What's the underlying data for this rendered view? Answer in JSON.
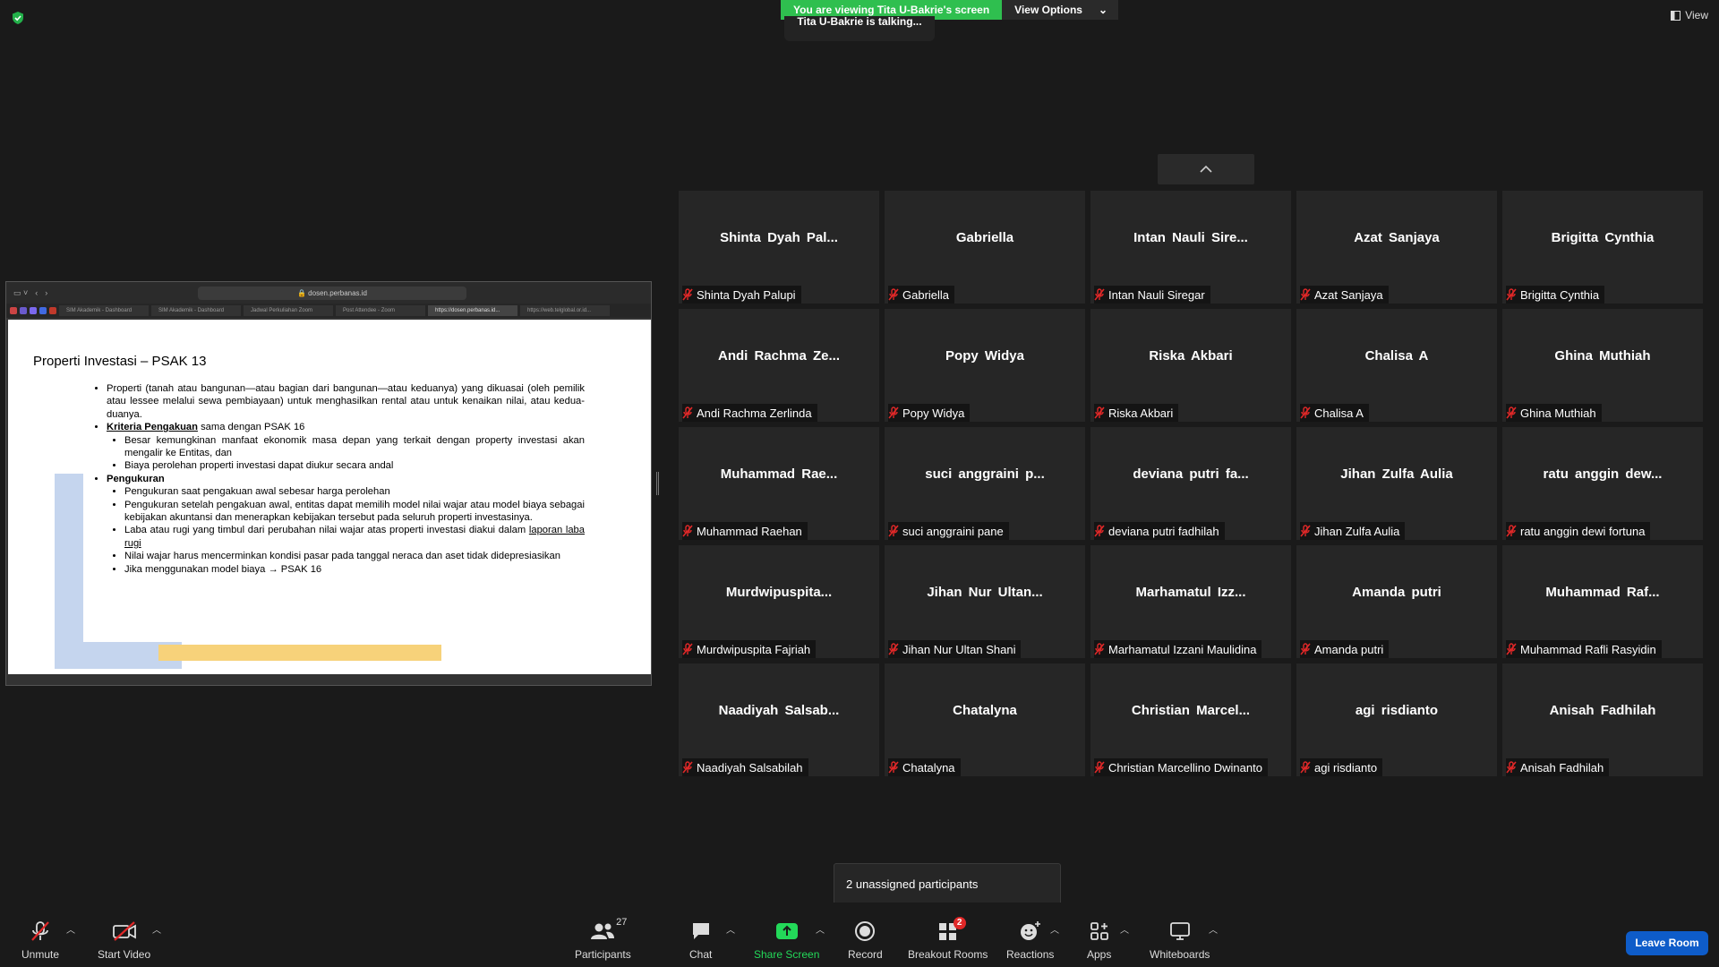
{
  "meeting": {
    "banner": "You are viewing Tita U-Bakrie's screen",
    "view_options": "View Options",
    "talking": "Tita U-Bakrie is talking...",
    "view": "View",
    "unassigned_popup": "2 unassigned participants"
  },
  "shared_screen": {
    "url": "dosen.perbanas.id",
    "tabs": [
      "SIM Akademik - Dashboard",
      "SIM Akademik - Dashboard",
      "Jadwal Perkuliahan Zoom",
      "Post Attendee - Zoom",
      "https://dosen.perbanas.id...",
      "https://web.telglobal.or.id..."
    ],
    "slide": {
      "title": "Properti  Investasi – PSAK 13",
      "b1": "Properti (tanah atau bangunan—atau bagian dari bangunan—atau keduanya) yang dikuasai (oleh pemilik atau lessee melalui sewa pembiayaan) untuk menghasilkan rental atau untuk kenaikan nilai, atau kedua-duanya.",
      "b2_label": "Kriteria Pengakuan",
      "b2_rest": " sama dengan PSAK 16",
      "b2_sub1": "Besar kemungkinan manfaat ekonomik masa depan yang terkait dengan property investasi akan mengalir ke Entitas, dan",
      "b2_sub2": "Biaya perolehan properti investasi dapat diukur secara andal",
      "b3_label": "Pengukuran",
      "b3_sub1": "Pengukuran saat pengakuan awal sebesar harga perolehan",
      "b3_sub2": "Pengukuran setelah pengakuan awal, entitas dapat memilih model nilai wajar atau model biaya sebagai kebijakan akuntansi dan menerapkan kebijakan tersebut pada seluruh properti investasinya.",
      "b3_sub3a": "Laba atau rugi yang timbul dari perubahan nilai wajar atas properti investasi diakui dalam ",
      "b3_sub3b": "laporan laba rugi",
      "b3_sub4": "Nilai wajar harus mencerminkan kondisi pasar pada tanggal neraca dan aset tidak didepresiasikan",
      "b3_sub5": "Jika menggunakan model biaya → PSAK 16"
    }
  },
  "participants": [
    {
      "big": "Shinta  Dyah  Pal...",
      "label": "Shinta Dyah Palupi"
    },
    {
      "big": "Gabriella",
      "label": "Gabriella"
    },
    {
      "big": "Intan  Nauli  Sire...",
      "label": "Intan Nauli Siregar"
    },
    {
      "big": "Azat Sanjaya",
      "label": "Azat Sanjaya"
    },
    {
      "big": "Brigitta Cynthia",
      "label": "Brigitta Cynthia"
    },
    {
      "big": "Andi  Rachma  Ze...",
      "label": "Andi Rachma Zerlinda"
    },
    {
      "big": "Popy Widya",
      "label": "Popy Widya"
    },
    {
      "big": "Riska Akbari",
      "label": "Riska Akbari"
    },
    {
      "big": "Chalisa A",
      "label": "Chalisa A"
    },
    {
      "big": "Ghina Muthiah",
      "label": "Ghina Muthiah"
    },
    {
      "big": "Muhammad  Rae...",
      "label": "Muhammad Raehan"
    },
    {
      "big": "suci  anggraini  p...",
      "label": "suci anggraini pane"
    },
    {
      "big": "deviana  putri  fa...",
      "label": "deviana putri fadhilah"
    },
    {
      "big": "Jihan Zulfa Aulia",
      "label": "Jihan Zulfa Aulia"
    },
    {
      "big": "ratu  anggin  dew...",
      "label": "ratu anggin dewi fortuna"
    },
    {
      "big": "Murdwipuspita...",
      "label": "Murdwipuspita Fajriah"
    },
    {
      "big": "Jihan  Nur  Ultan...",
      "label": "Jihan Nur Ultan Shani"
    },
    {
      "big": "Marhamatul  Izz...",
      "label": "Marhamatul Izzani Maulidina"
    },
    {
      "big": "Amanda putri",
      "label": "Amanda putri"
    },
    {
      "big": "Muhammad  Raf...",
      "label": "Muhammad Rafli Rasyidin"
    },
    {
      "big": "Naadiyah  Salsab...",
      "label": "Naadiyah Salsabilah"
    },
    {
      "big": "Chatalyna",
      "label": "Chatalyna"
    },
    {
      "big": "Christian  Marcel...",
      "label": "Christian Marcellino Dwinanto"
    },
    {
      "big": "agi risdianto",
      "label": "agi risdianto"
    },
    {
      "big": "Anisah Fadhilah",
      "label": "Anisah Fadhilah"
    }
  ],
  "toolbar": {
    "unmute": "Unmute",
    "start_video": "Start Video",
    "participants": "Participants",
    "participants_count": "27",
    "chat": "Chat",
    "share_screen": "Share Screen",
    "record": "Record",
    "breakout_rooms": "Breakout Rooms",
    "breakout_badge": "2",
    "reactions": "Reactions",
    "apps": "Apps",
    "whiteboards": "Whiteboards",
    "leave_room": "Leave Room"
  },
  "colors": {
    "banner_green": "#2fbf4f",
    "share_green": "#23d959",
    "leave_blue": "#0e5cc9",
    "mute_red": "#e02828"
  }
}
